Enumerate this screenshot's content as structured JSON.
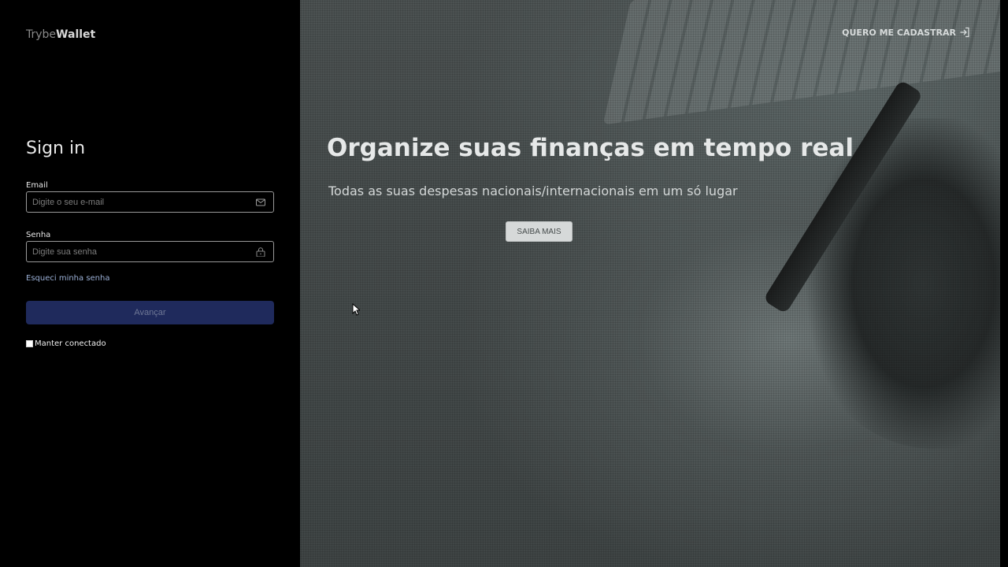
{
  "brand": {
    "part1": "Trybe",
    "part2": "Wallet"
  },
  "signin": {
    "title": "Sign in",
    "email_label": "Email",
    "email_placeholder": "Digite o seu e-mail",
    "password_label": "Senha",
    "password_placeholder": "Digite sua senha",
    "forgot_link": "Esqueci minha senha",
    "submit_label": "Avançar",
    "keep_connected": "Manter conectado"
  },
  "hero": {
    "register_link": "QUERO ME CADASTRAR",
    "headline": "Organize suas finanças em tempo real",
    "subline": "Todas as suas despesas nacionais/internacionais em um só lugar",
    "learn_more": "SAIBA MAIS"
  },
  "icons": {
    "email": "mail-icon",
    "password": "lock-icon",
    "register": "sign-in-icon"
  },
  "colors": {
    "submit_bg": "#1f2a5c",
    "forgot_link": "#9bb0d6"
  }
}
